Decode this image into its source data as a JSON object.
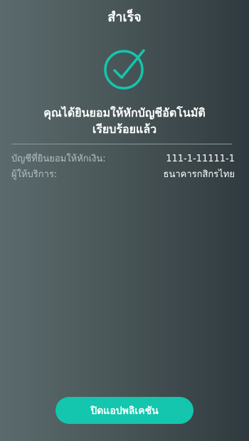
{
  "header": {
    "title": "สำเร็จ"
  },
  "status": {
    "icon": "check-circle-icon",
    "accent_color": "#13c6ad",
    "message_line1": "คุณได้ยินยอมให้หักบัญชีอัตโนมัติ",
    "message_line2": "เรียบร้อยแล้ว"
  },
  "details": [
    {
      "label": "บัญชีที่ยินยอมให้หักเงิน:",
      "value": "111-1-11111-1"
    },
    {
      "label": "ผู้ให้บริการ:",
      "value": "ธนาคารกสิกรไทย"
    }
  ],
  "actions": {
    "close_label": "ปิดแอปพลิเคชัน",
    "close_color": "#13c6ad"
  }
}
